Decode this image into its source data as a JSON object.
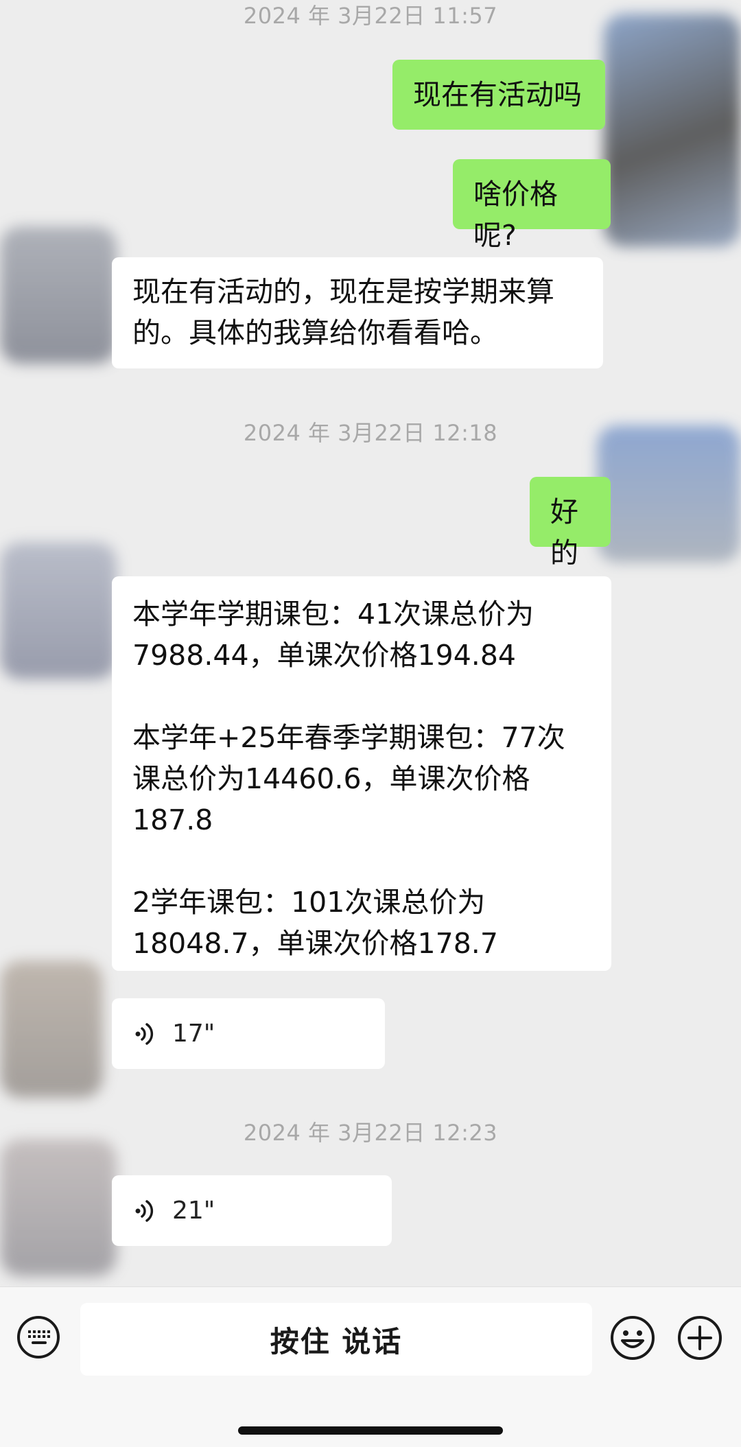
{
  "chat": {
    "timestamps": [
      "2024 年 3月22日 11:57",
      "2024 年 3月22日 12:18",
      "2024 年 3月22日 12:23"
    ],
    "messages": {
      "m1": "现在有活动吗",
      "m2": "啥价格呢?",
      "m3": "现在有活动的，现在是按学期来算\n的。具体的我算给你看看哈。",
      "m4": "好的",
      "m5": "本学年学期课包：41次课总价为\n7988.44，单课次价格194.84\n\n本学年+25年春季学期课包：77次\n课总价为14460.6，单课次价格\n187.8\n\n2学年课包：101次课总价为\n18048.7，单课次价格178.7"
    },
    "voice": {
      "v1": "17\"",
      "v2": "21\""
    }
  },
  "input_bar": {
    "hold_to_talk_label": "按住 说话",
    "left_icon": "keyboard-icon",
    "emoji_icon": "emoji-icon",
    "plus_icon": "plus-icon"
  },
  "colors": {
    "background": "#ededed",
    "sent_bubble": "#95ec69",
    "received_bubble": "#ffffff",
    "timestamp_text": "#a8a8a8"
  }
}
